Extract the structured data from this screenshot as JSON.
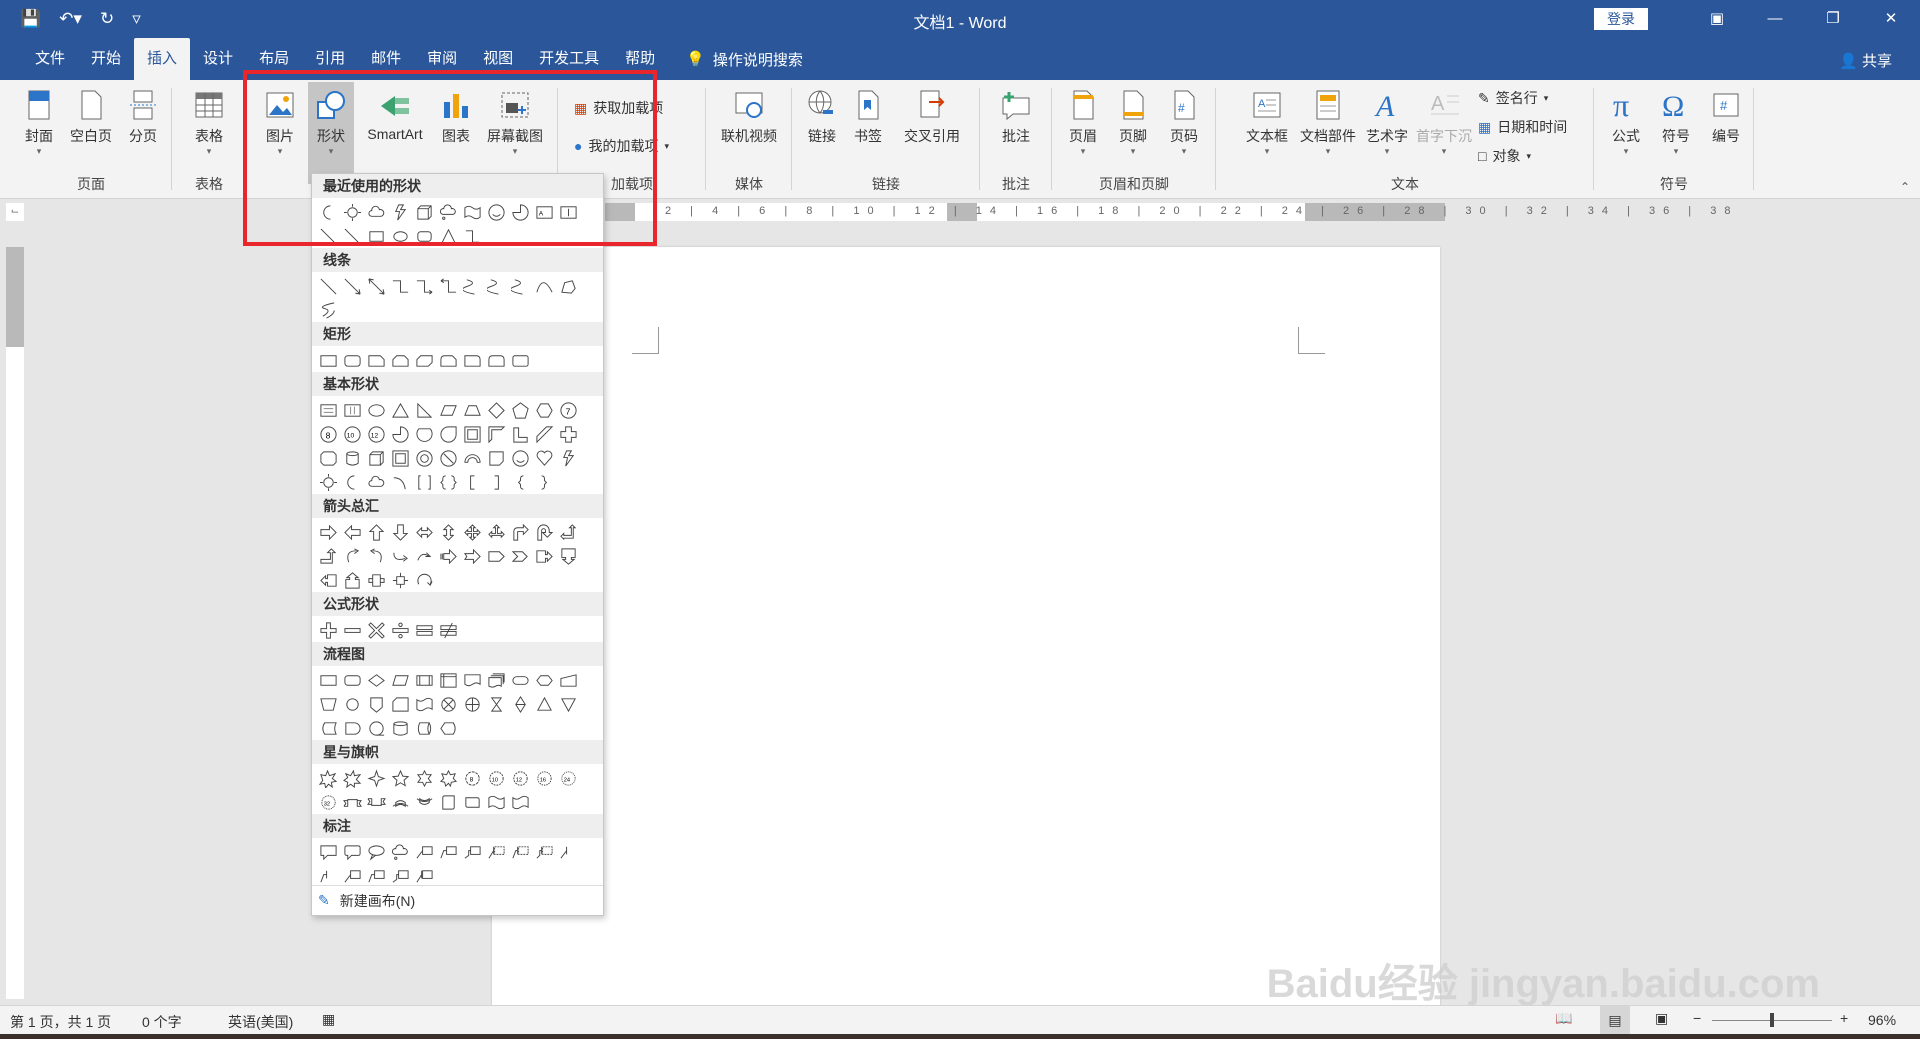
{
  "titlebar": {
    "title": "文档1  -  Word",
    "login": "登录",
    "bg": "#2b579a"
  },
  "tabs": [
    "文件",
    "开始",
    "插入",
    "设计",
    "布局",
    "引用",
    "邮件",
    "审阅",
    "视图",
    "开发工具",
    "帮助"
  ],
  "active_tab": "插入",
  "tellme": "操作说明搜索",
  "share": "共享",
  "ribbon": {
    "groups": {
      "pages": {
        "label": "页面",
        "buttons": [
          "封面",
          "空白页",
          "分页"
        ]
      },
      "tables": {
        "label": "表格",
        "buttons": [
          "表格"
        ]
      },
      "illustrations": {
        "buttons": [
          "图片",
          "形状",
          "SmartArt",
          "图表",
          "屏幕截图"
        ]
      },
      "addins": {
        "label": "加载项",
        "buttons": [
          "获取加载项",
          "我的加载项"
        ]
      },
      "media": {
        "label": "媒体",
        "buttons": [
          "联机视频"
        ]
      },
      "links": {
        "label": "链接",
        "buttons": [
          "链接",
          "书签",
          "交叉引用"
        ]
      },
      "comments": {
        "label": "批注",
        "buttons": [
          "批注"
        ]
      },
      "headerfooter": {
        "label": "页眉和页脚",
        "buttons": [
          "页眉",
          "页脚",
          "页码"
        ]
      },
      "text": {
        "label": "文本",
        "buttons": [
          "文本框",
          "文档部件",
          "艺术字",
          "首字下沉"
        ],
        "small": [
          "签名行",
          "日期和时间",
          "对象"
        ]
      },
      "symbols": {
        "label": "符号",
        "buttons": [
          "公式",
          "符号",
          "编号"
        ]
      }
    }
  },
  "shapes_menu": {
    "sections": [
      "最近使用的形状",
      "线条",
      "矩形",
      "基本形状",
      "箭头总汇",
      "公式形状",
      "流程图",
      "星与旗帜",
      "标注"
    ],
    "new_canvas": "新建画布(N)"
  },
  "status": {
    "page": "第 1 页，共 1 页",
    "words": "0 个字",
    "lang": "英语(美国)",
    "zoom": "96%"
  },
  "watermark": "Baidu经验 jingyan.baidu.com"
}
